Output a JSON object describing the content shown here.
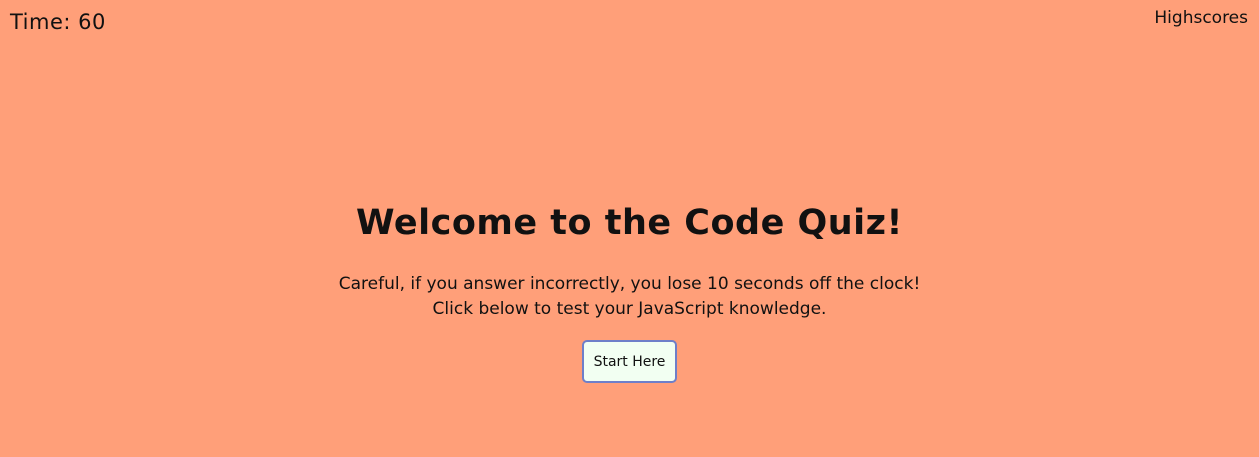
{
  "header": {
    "timer_label": "Time: 60",
    "highscores_link": "Highscores"
  },
  "main": {
    "title": "Welcome to the Code Quiz!",
    "intro_line1": "Careful, if you answer incorrectly, you lose 10 seconds off the clock!",
    "intro_line2": "Click below to test your JavaScript knowledge.",
    "start_button": "Start Here"
  },
  "colors": {
    "background": "#ff9f79",
    "button_bg": "#f2fff2",
    "button_border": "#6e7fc9"
  }
}
